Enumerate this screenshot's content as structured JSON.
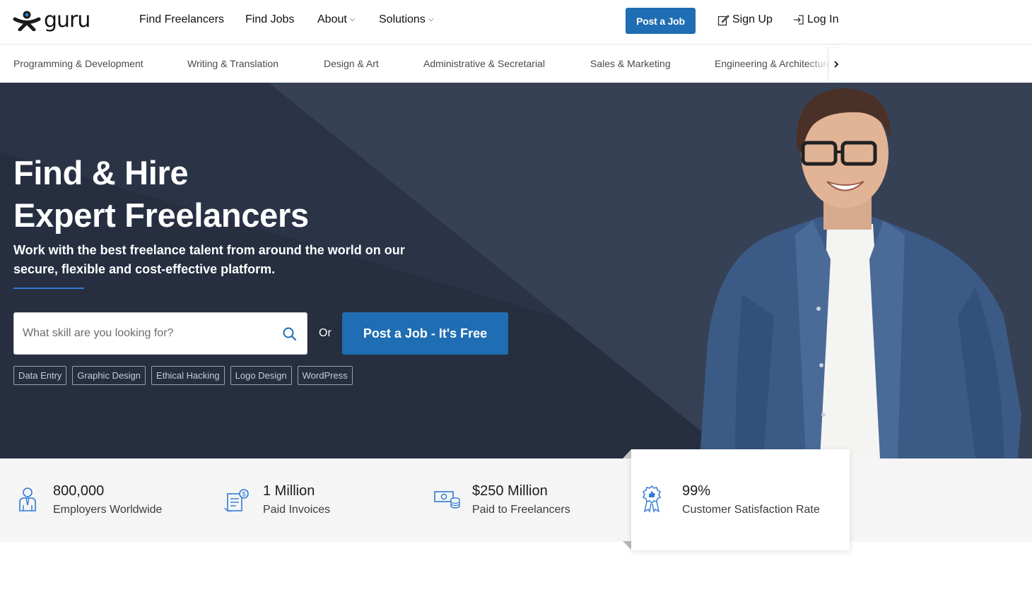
{
  "brand": {
    "name": "guru"
  },
  "nav": {
    "links": [
      {
        "label": "Find Freelancers"
      },
      {
        "label": "Find Jobs"
      },
      {
        "label": "About"
      },
      {
        "label": "Solutions"
      }
    ],
    "post_job_label": "Post a Job",
    "sign_up_label": "Sign Up",
    "log_in_label": "Log In"
  },
  "categories": [
    "Programming & Development",
    "Writing & Translation",
    "Design & Art",
    "Administrative & Secretarial",
    "Sales & Marketing",
    "Engineering & Architecture"
  ],
  "hero": {
    "title_line1": "Find & Hire",
    "title_line2": "Expert Freelancers",
    "subtitle": "Work with the best freelance talent from around the world on our secure, flexible and cost-effective platform.",
    "search_placeholder": "What skill are you looking for?",
    "or_label": "Or",
    "post_job_label": "Post a Job - It's Free",
    "chips": [
      "Data Entry",
      "Graphic Design",
      "Ethical Hacking",
      "Logo Design",
      "WordPress"
    ]
  },
  "stats": [
    {
      "value": "800,000",
      "label": "Employers Worldwide",
      "icon": "employer-icon"
    },
    {
      "value": "1 Million",
      "label": "Paid Invoices",
      "icon": "invoice-icon"
    },
    {
      "value": "$250 Million",
      "label": "Paid to Freelancers",
      "icon": "money-icon"
    },
    {
      "value": "99%",
      "label": "Customer Satisfaction Rate",
      "icon": "award-badge-icon"
    }
  ],
  "colors": {
    "primary_blue": "#1f6db2",
    "hero_dark": "#2b3347",
    "hero_light": "#3a4459",
    "stats_bg": "#f5f5f5",
    "icon_blue": "#2f7cd3"
  }
}
